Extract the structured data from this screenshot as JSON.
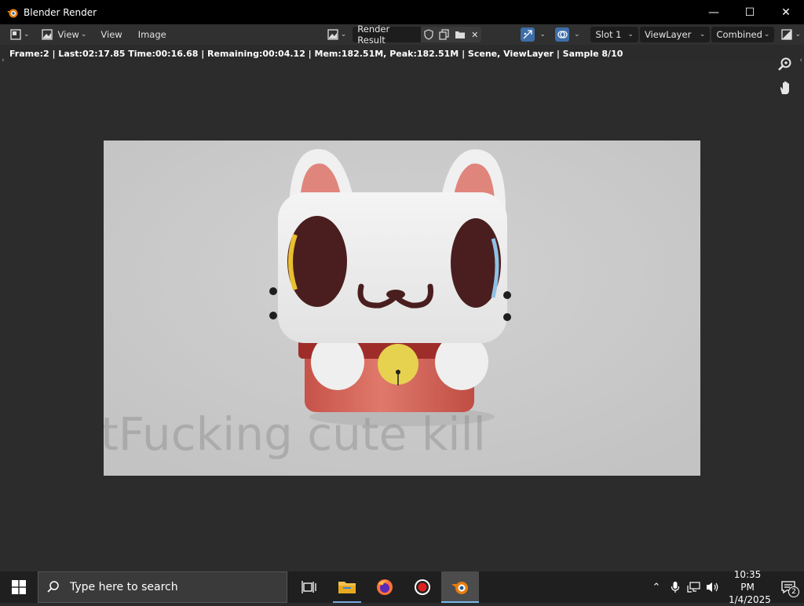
{
  "window": {
    "title": "Blender Render"
  },
  "toolbar": {
    "view_menu": "View",
    "view_label": "View",
    "image_label": "Image",
    "image_name": "Render Result",
    "slot": "Slot 1",
    "view_layer": "ViewLayer",
    "pass": "Combined"
  },
  "status": {
    "text": "Frame:2 | Last:02:17.85 Time:00:16.68 | Remaining:00:04.12 | Mem:182.51M, Peak:182.51M | Scene, ViewLayer | Sample 8/10"
  },
  "render": {
    "watermark": "tFucking cute kill"
  },
  "taskbar": {
    "search_placeholder": "Type here to search",
    "time": "10:35 PM",
    "date": "1/4/2025",
    "notification_count": "2"
  },
  "colors": {
    "accent": "#3d6ea8",
    "render_bg": "#c8c8c8",
    "cat_fur": "#f2f2f2",
    "cat_body": "#d9685c",
    "eye": "#4a1e1e",
    "bell": "#e8d24a"
  }
}
